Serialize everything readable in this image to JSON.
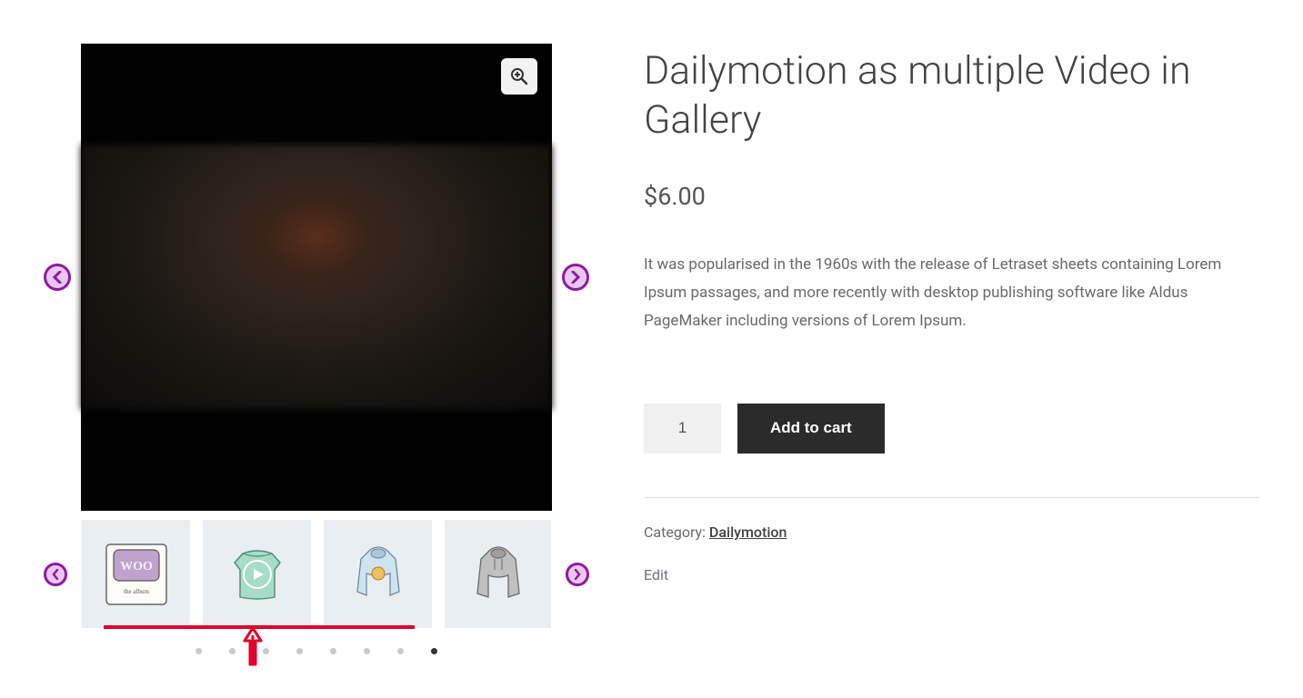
{
  "product": {
    "title": "Dailymotion as multiple Video in Gallery",
    "currency": "$",
    "price": "6.00",
    "description": "It was popularised in the 1960s with the release of Letraset sheets containing Lorem Ipsum passages, and more recently with desktop publishing software like Aldus PageMaker including versions of Lorem Ipsum.",
    "quantity": "1",
    "add_to_cart_label": "Add to cart",
    "category_label": "Category: ",
    "category_link": "Dailymotion",
    "edit_label": "Edit"
  },
  "gallery": {
    "thumbs": [
      {
        "name": "woo-album-thumb"
      },
      {
        "name": "green-sweater-video-thumb"
      },
      {
        "name": "blue-hoodie-thumb"
      },
      {
        "name": "grey-hoodie-thumb"
      }
    ],
    "dots": {
      "count": 8,
      "active_index": 7
    }
  }
}
